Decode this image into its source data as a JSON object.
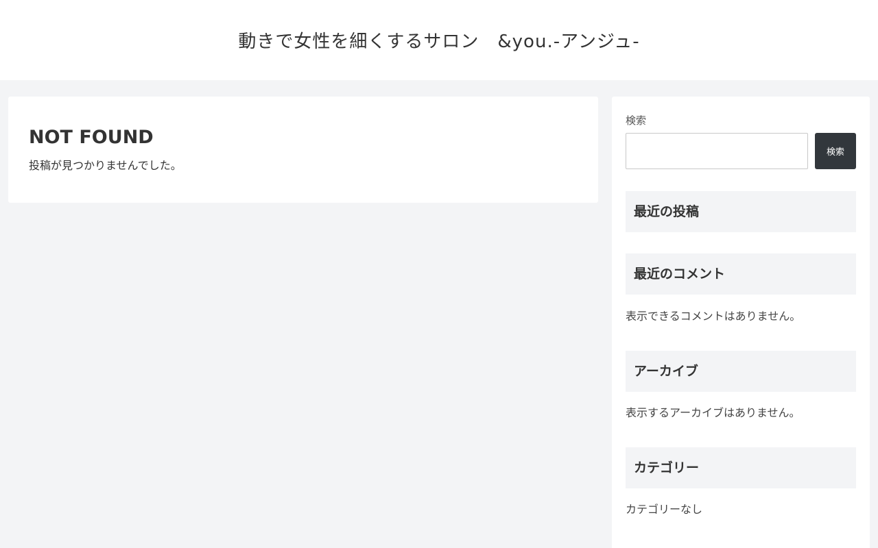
{
  "header": {
    "site_title": "動きで女性を細くするサロン　&you.-アンジュ-"
  },
  "main": {
    "heading": "NOT FOUND",
    "message": "投稿が見つかりませんでした。"
  },
  "sidebar": {
    "search": {
      "label": "検索",
      "input_value": "",
      "placeholder": "",
      "button_label": "検索"
    },
    "recent_posts": {
      "title": "最近の投稿"
    },
    "recent_comments": {
      "title": "最近のコメント",
      "empty_text": "表示できるコメントはありません。"
    },
    "archives": {
      "title": "アーカイブ",
      "empty_text": "表示するアーカイブはありません。"
    },
    "categories": {
      "title": "カテゴリー",
      "empty_text": "カテゴリーなし"
    }
  },
  "colors": {
    "page_background": "#f3f4f6",
    "card_background": "#ffffff",
    "button_background": "#32373c",
    "text": "#333333"
  }
}
